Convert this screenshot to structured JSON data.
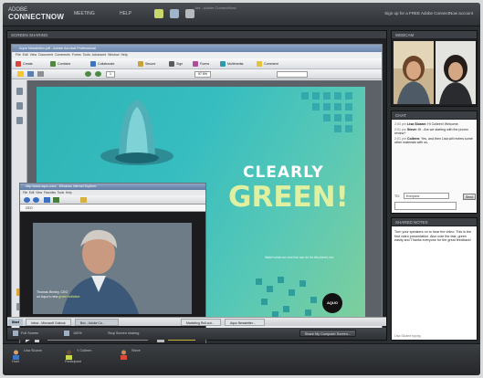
{
  "topbar": {
    "logo_top": "ADOBE",
    "logo_name": "CONNECTNOW",
    "menus": [
      "MEETING",
      "HELP"
    ],
    "title": "Joe - Adobe ConnectNow",
    "signup": "Sign up for a FREE Adobe ConnectNow account"
  },
  "share_pod": {
    "header": "SCREEN SHARING",
    "acrobat": {
      "title": "Aquo Newsletter.pdf - Adobe Acrobat Professional",
      "menu": [
        "File",
        "Edit",
        "View",
        "Document",
        "Comments",
        "Forms",
        "Tools",
        "Advanced",
        "Window",
        "Help"
      ],
      "toolbar1": [
        "Create",
        "Combine",
        "Collaborate",
        "Secure",
        "Sign",
        "Forms",
        "Multimedia",
        "Comment"
      ],
      "page_num": "1",
      "zoom": "97.5%"
    },
    "poster": {
      "headline1": "CLEARLY",
      "headline2": "GREEN!",
      "tagline": "Watch what our new line can do for the planet, too.",
      "badge": "AQUO"
    },
    "player": {
      "title": "http://www.aquo.com/ - Windows Internet Explorer",
      "menu": [
        "File",
        "Edit",
        "View",
        "Favorites",
        "Tools",
        "Help"
      ],
      "address": "CEO",
      "caption_name": "Thomas Bexley, CEO",
      "caption_text": "on Aquo's new",
      "caption_highlight": "green initiative"
    },
    "taskbar": {
      "start": "Start",
      "items": [
        "Inbox - Microsoft Outlook",
        "Box - Adobe Co...",
        "Marketing Roll-out...",
        "Aquo Newsletter..."
      ]
    },
    "sharebar": {
      "full_screen": "Full Screen",
      "zoom": "100%",
      "stop_label": "Stop Screen sharing",
      "button": "Share My Computer Screen..."
    }
  },
  "webcam": {
    "header": "WEBCAM"
  },
  "chat": {
    "header": "CHAT",
    "messages": [
      {
        "time": "2:00 pm",
        "name": "Lisa Sloane:",
        "text": "Hi Colleen! Welcome."
      },
      {
        "time": "2:01 pm",
        "name": "Steve:",
        "text": "Hi - Are we starting with the promo review?"
      },
      {
        "time": "2:01 pm",
        "name": "Colleen:",
        "text": "Yes, and then Lisa will review some other materials with us."
      }
    ],
    "to_label": "TO:",
    "to_value": "Everyone",
    "send": "Send"
  },
  "notes": {
    "header": "SHARED NOTES",
    "body": "Turn your speakers on to hear the video. This is the first video presentation. Also note the fast, green easily and Thanks everyone for the great feedback!",
    "footer": "Lisa Sloane typing"
  },
  "attendees": [
    {
      "name": "Lisa Sloane",
      "sub": "Host"
    },
    {
      "name": "Y Colleen",
      "sub": "Participant"
    },
    {
      "name": "Steve",
      "sub": ""
    }
  ],
  "colors": {
    "accent": "#c3d84a",
    "poster": "#36bdc0",
    "chrome": "#2b2e31"
  }
}
